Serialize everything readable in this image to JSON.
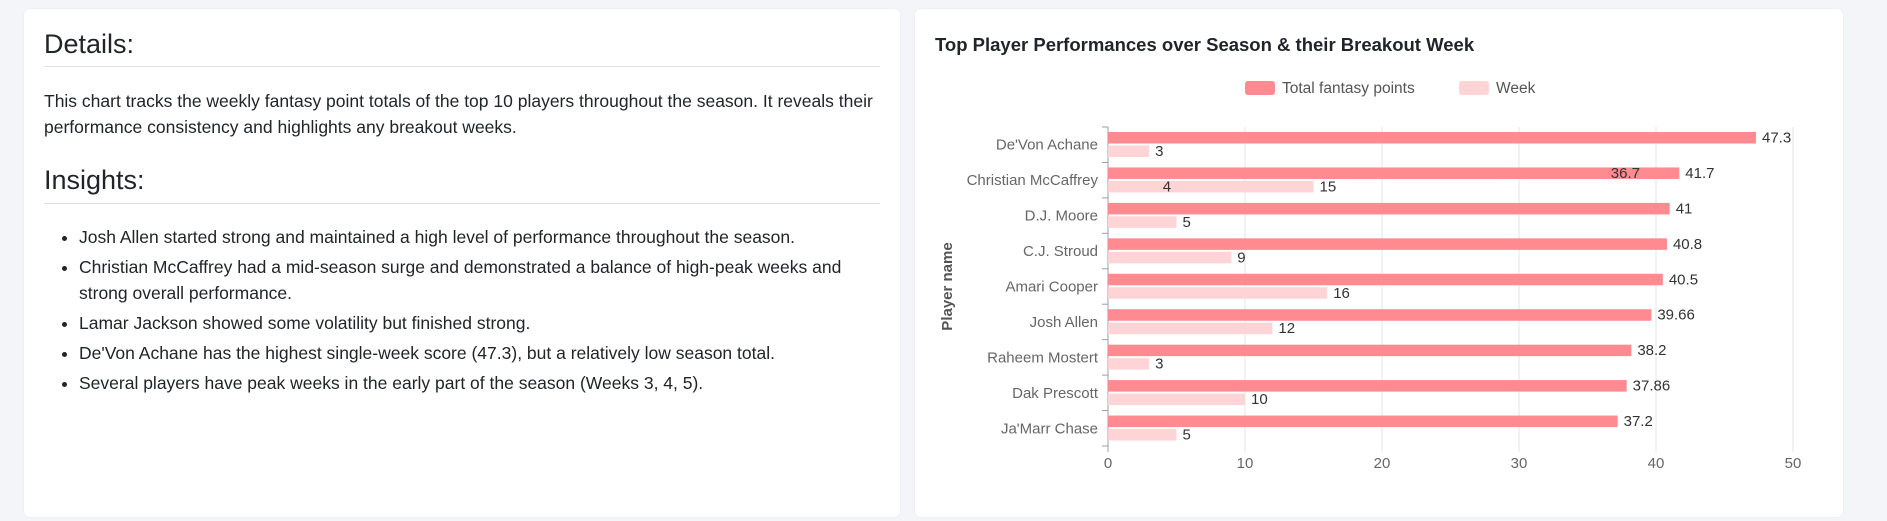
{
  "details": {
    "heading": "Details:",
    "text": "This chart tracks the weekly fantasy point totals of the top 10 players throughout the season. It reveals their performance consistency and highlights any breakout weeks."
  },
  "insights": {
    "heading": "Insights:",
    "items": [
      "Josh Allen started strong and maintained a high level of performance throughout the season.",
      "Christian McCaffrey had a mid-season surge and demonstrated a balance of high-peak weeks and strong overall performance.",
      "Lamar Jackson showed some volatility but finished strong.",
      "De'Von Achane has the highest single-week score (47.3), but a relatively low season total.",
      "Several players have peak weeks in the early part of the season (Weeks 3, 4, 5)."
    ]
  },
  "chart_data": {
    "type": "bar",
    "orientation": "horizontal",
    "title": "Top Player Performances over Season & their Breakout Week",
    "ylabel": "Player name",
    "xlabel": "",
    "xlim": [
      0,
      50
    ],
    "xticks": [
      0,
      10,
      20,
      30,
      40,
      50
    ],
    "grid": true,
    "legend_position": "top-center",
    "categories": [
      "De'Von Achane",
      "Christian McCaffrey",
      "D.J. Moore",
      "C.J. Stroud",
      "Amari Cooper",
      "Josh Allen",
      "Raheem Mostert",
      "Dak Prescott",
      "Ja'Marr Chase"
    ],
    "series": [
      {
        "name": "Total fantasy points",
        "color": "#ff8a8f",
        "values": [
          47.3,
          41.7,
          41,
          40.8,
          40.5,
          39.66,
          38.2,
          37.86,
          37.2
        ],
        "labels": [
          "47.3",
          "41.7",
          "41",
          "40.8",
          "40.5",
          "39.66",
          "38.2",
          "37.86",
          "37.2"
        ]
      },
      {
        "name": "Week",
        "color": "#ffd4d6",
        "values": [
          3,
          15,
          5,
          9,
          16,
          12,
          3,
          10,
          5
        ],
        "labels": [
          "3",
          "15",
          "5",
          "9",
          "16",
          "12",
          "3",
          "10",
          "5"
        ]
      }
    ],
    "annotations": [
      {
        "category": "Christian McCaffrey",
        "text": "36.7",
        "value": 36.7
      },
      {
        "category": "Christian McCaffrey",
        "text": "4",
        "value": 4
      }
    ]
  }
}
